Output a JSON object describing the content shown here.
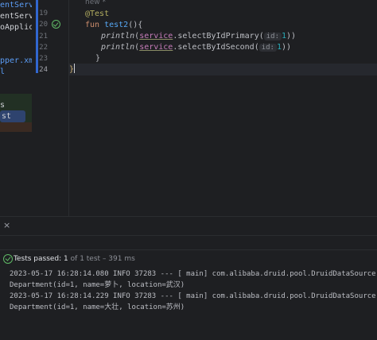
{
  "project": {
    "items": [
      {
        "label": "entServi",
        "style": "blue"
      },
      {
        "label": "entServic",
        "style": "normal"
      },
      {
        "label": "oApplica",
        "style": "normal"
      },
      {
        "label": "pper.xml",
        "style": "blue"
      },
      {
        "label": "l",
        "style": "blue"
      },
      {
        "label": "s",
        "style": "normal"
      },
      {
        "label": "st",
        "style": "normal"
      }
    ]
  },
  "editor": {
    "line_numbers": [
      "19",
      "20",
      "21",
      "22",
      "23",
      "24"
    ],
    "current_line": "24",
    "top_hint": "new *",
    "annotation": "@Test",
    "fun_keyword": "fun",
    "fun_name": "test2",
    "fun_sig_rest": "(){",
    "call1": {
      "fn": "println",
      "open": "(",
      "field": "service",
      "method": ".selectByIdPrimary(",
      "hint": "id:",
      "arg": "1",
      "close": "))"
    },
    "call2": {
      "fn": "println",
      "open": "(",
      "field": "service",
      "method": ".selectByIdSecond(",
      "hint": "id:",
      "arg": "1",
      "close": "))"
    },
    "inner_close": "}",
    "outer_close": "}"
  },
  "run_panel": {
    "close_glyph": "×",
    "status_prefix": "Tests passed:",
    "passed_count": "1",
    "status_rest": "of 1 test – 391 ms"
  },
  "console": {
    "lines": [
      "2023-05-17 16:28:14.080  INFO 37283 --- [           main] com.alibaba.druid.pool.DruidDataSource",
      "Department(id=1, name=萝卜, location=武汉)",
      "2023-05-17 16:28:14.229  INFO 37283 --- [           main] com.alibaba.druid.pool.DruidDataSource",
      "Department(id=1, name=大壮, location=苏州)"
    ]
  },
  "colors": {
    "background": "#1e1f22",
    "keyword": "#cf8e6d",
    "annotation": "#b3ae60",
    "function": "#56a8f5",
    "field": "#c77dbb",
    "number": "#2aacb8",
    "success": "#5fb865",
    "vcs_marker": "#3574f0"
  }
}
